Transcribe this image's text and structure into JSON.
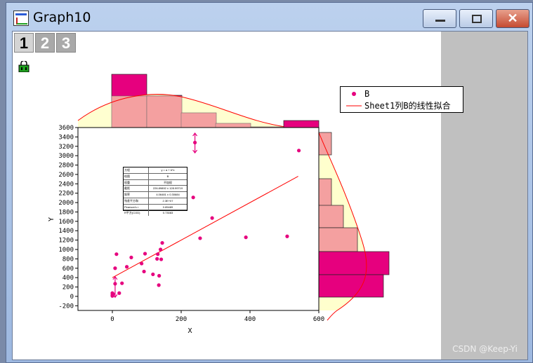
{
  "window": {
    "title": "Graph10",
    "minimize_icon": "minimize-icon",
    "maximize_icon": "maximize-icon",
    "close_icon": "close-icon",
    "close_glyph": "✕"
  },
  "layers": {
    "tabs": [
      {
        "label": "1",
        "active": true
      },
      {
        "label": "2",
        "active": false
      },
      {
        "label": "3",
        "active": false
      }
    ],
    "lock_icon": "lock-icon"
  },
  "legend": {
    "items": [
      {
        "label": "B",
        "symbol": "circle",
        "color": "#e6007e"
      },
      {
        "label": "Sheet1列B的线性拟合",
        "symbol": "line",
        "color": "#ff0000"
      }
    ]
  },
  "stats_table": {
    "rows": [
      [
        "方程",
        "y = a + b*x"
      ],
      [
        "绘图",
        "B"
      ],
      [
        "权重",
        "不加权"
      ],
      [
        "截距",
        "226.89892 ± 128.99719"
      ],
      [
        "斜率",
        "4.06481 ± 0.30684"
      ],
      [
        "残差平方和",
        "2.3E+07"
      ],
      [
        "Pearson's r",
        "0.85489"
      ],
      [
        "R平方(COD)",
        "0.73083"
      ]
    ]
  },
  "watermark": "CSDN @Keep-Yi",
  "chart_data": {
    "type": "scatter",
    "xlabel": "X",
    "ylabel": "Y",
    "xlim": [
      -100,
      600
    ],
    "ylim": [
      -300,
      3600
    ],
    "x_ticks": [
      0,
      200,
      400,
      600
    ],
    "y_ticks": [
      -200,
      0,
      200,
      400,
      600,
      800,
      1000,
      1200,
      1400,
      1600,
      1800,
      2000,
      2200,
      2400,
      2600,
      2800,
      3000,
      3200,
      3400,
      3600
    ],
    "series": [
      {
        "name": "B",
        "marker_color": "#e6007e",
        "points": [
          [
            0,
            10
          ],
          [
            0,
            30
          ],
          [
            0,
            70
          ],
          [
            2,
            50
          ],
          [
            8,
            270
          ],
          [
            8,
            600
          ],
          [
            12,
            900
          ],
          [
            20,
            70
          ],
          [
            28,
            280
          ],
          [
            42,
            630
          ],
          [
            55,
            830
          ],
          [
            85,
            700
          ],
          [
            92,
            530
          ],
          [
            95,
            910
          ],
          [
            118,
            470
          ],
          [
            130,
            800
          ],
          [
            132,
            900
          ],
          [
            135,
            240
          ],
          [
            136,
            440
          ],
          [
            140,
            1000
          ],
          [
            142,
            790
          ],
          [
            145,
            1140
          ],
          [
            235,
            2110
          ],
          [
            255,
            1240
          ],
          [
            290,
            1670
          ],
          [
            388,
            1260
          ],
          [
            508,
            1280
          ],
          [
            542,
            3110
          ],
          [
            240,
            3280
          ]
        ]
      },
      {
        "name": "Sheet1列B的线性拟合",
        "line_color": "#ff0000",
        "line": [
          [
            0,
            400
          ],
          [
            540,
            2560
          ]
        ]
      }
    ],
    "top_histogram": {
      "bars_fill": "#e6007e",
      "overlay_fill": "#f4a0a0"
    },
    "right_histogram": {
      "bars_fill": "#e6007e",
      "overlay_fill": "#f4a0a0"
    }
  }
}
